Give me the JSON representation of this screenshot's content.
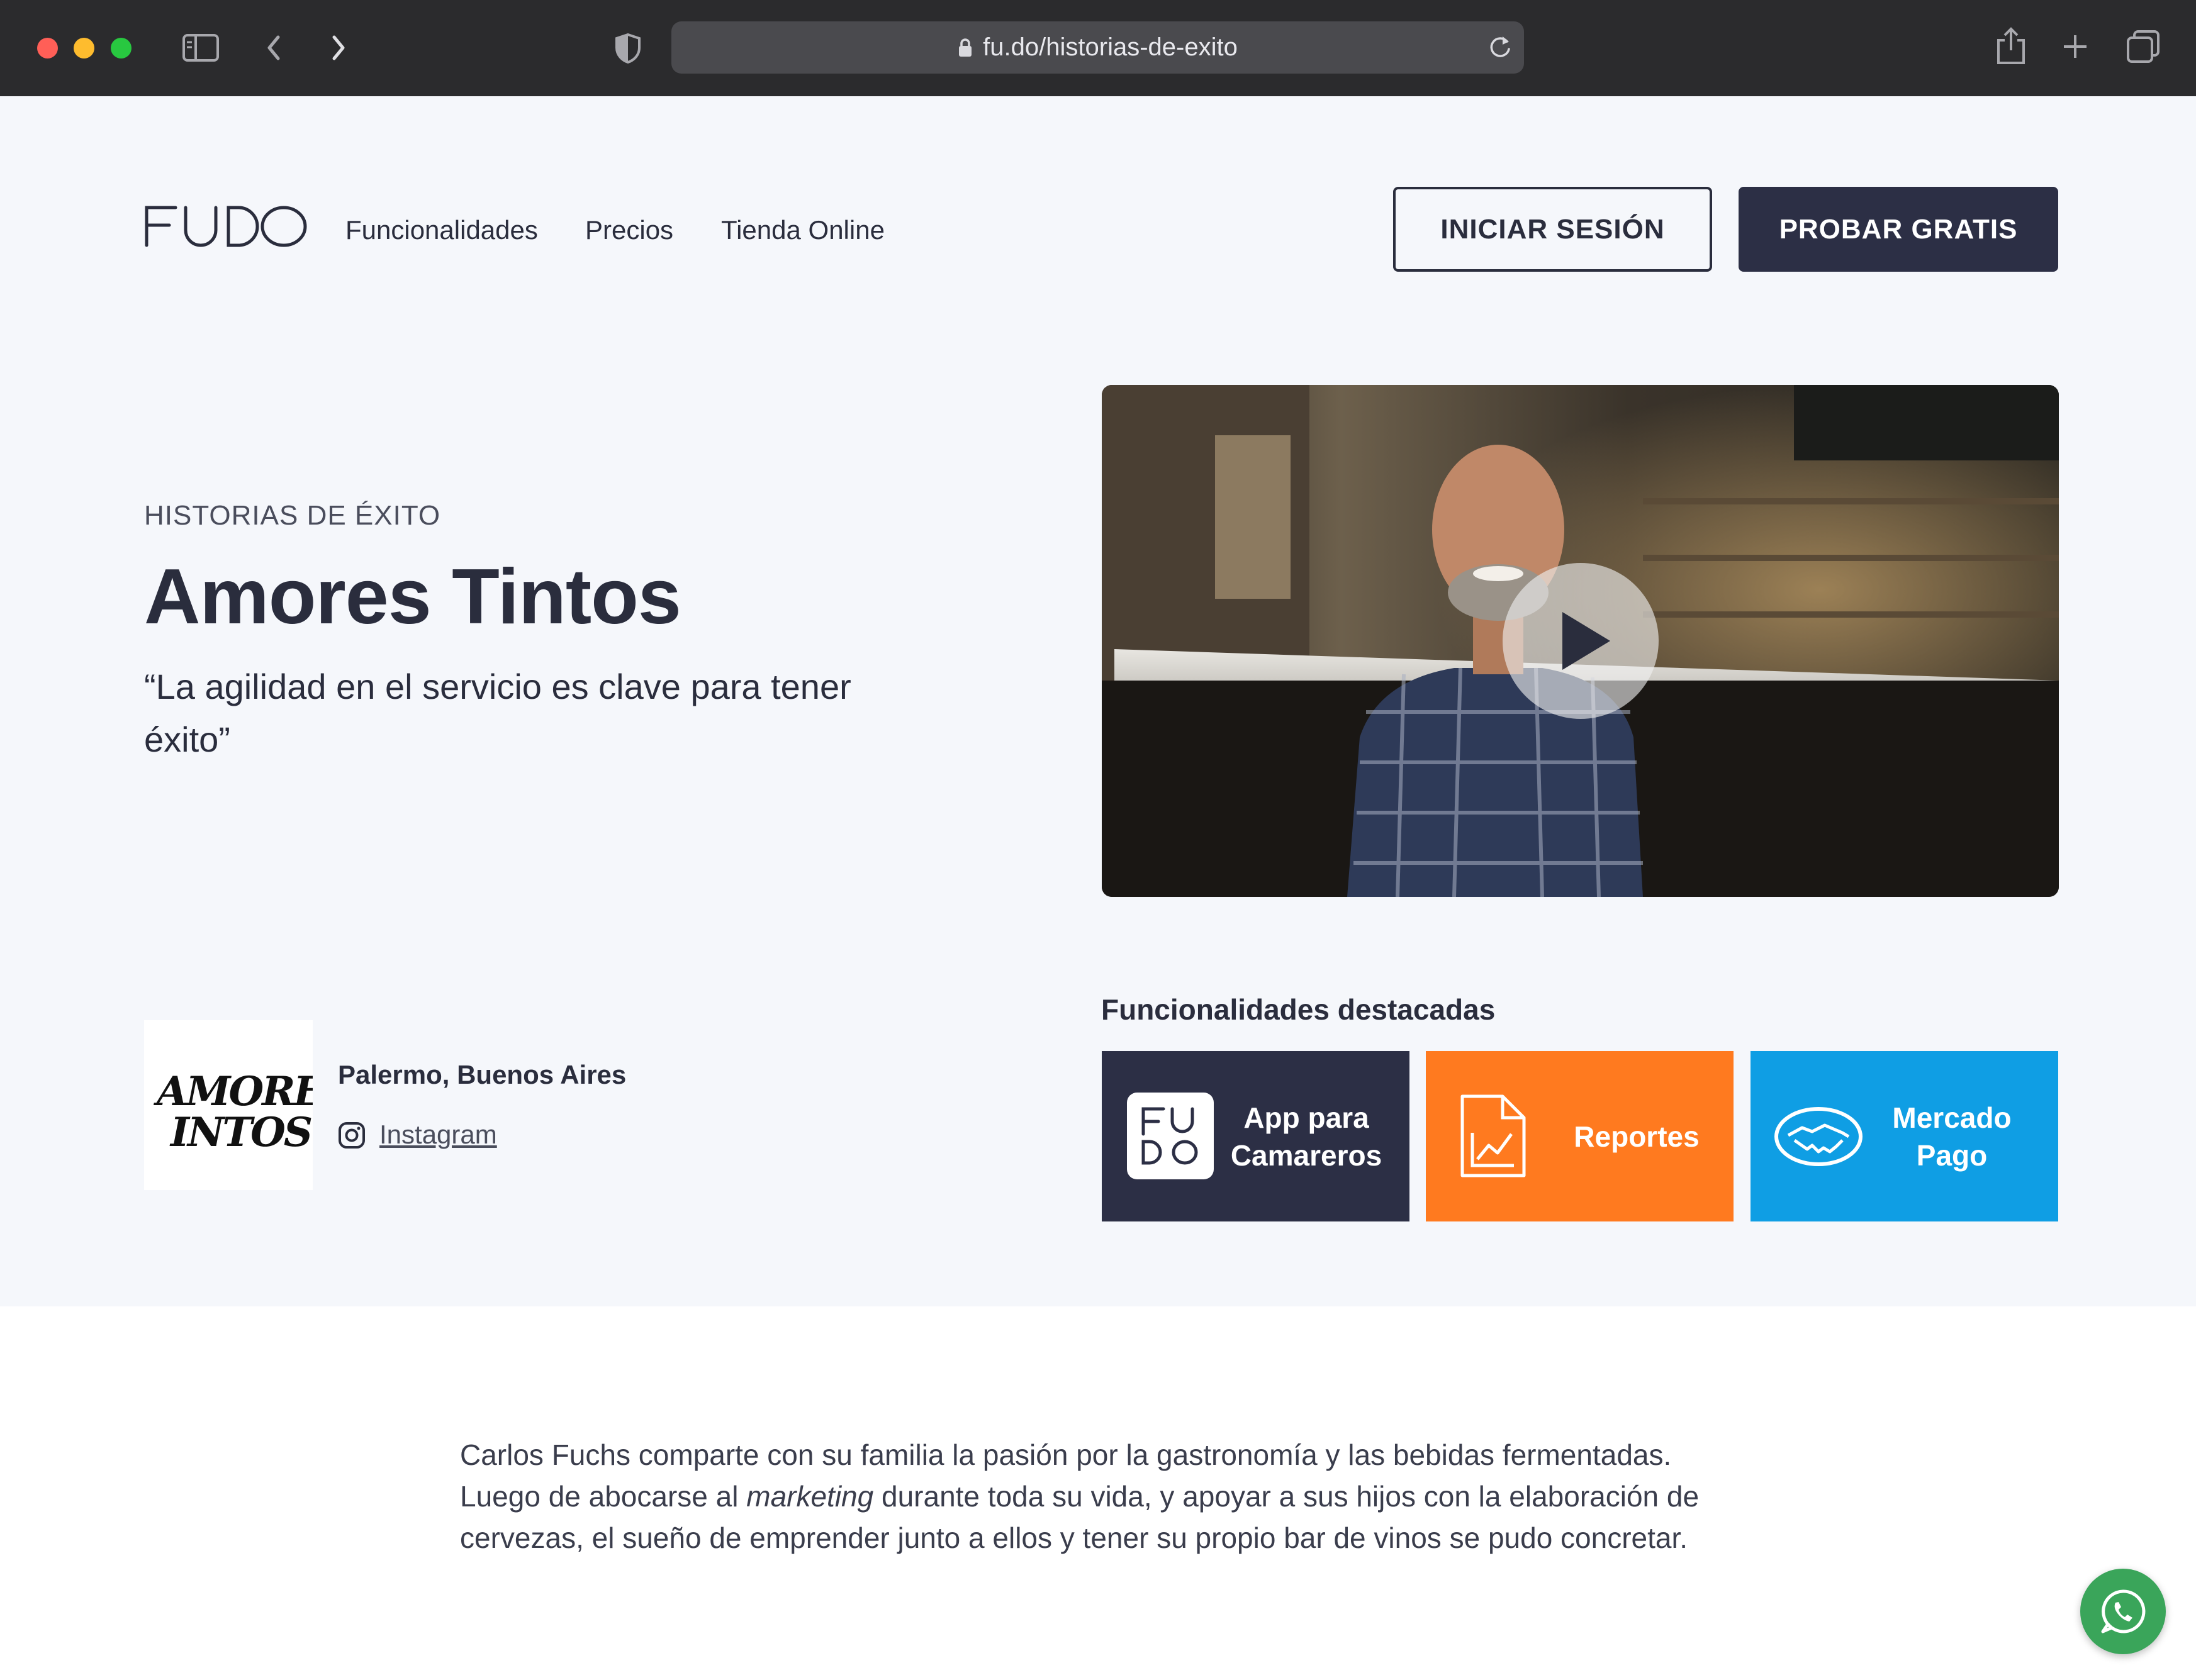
{
  "browser": {
    "url": "fu.do/historias-de-exito",
    "traffic_colors": [
      "#ff5f57",
      "#febc2e",
      "#28c840"
    ]
  },
  "header": {
    "brand": "FUDO",
    "nav": [
      "Funcionalidades",
      "Precios",
      "Tienda Online"
    ],
    "login_label": "INICIAR SESIÓN",
    "trial_label": "PROBAR GRATIS"
  },
  "hero": {
    "eyebrow": "HISTORIAS DE ÉXITO",
    "title": "Amores Tintos",
    "quote": "“La agilidad en el servicio es clave para tener éxito”"
  },
  "business": {
    "logo_text": "AMORES INTOS",
    "location": "Palermo, Buenos Aires",
    "social_label": "Instagram"
  },
  "features": {
    "heading": "Funcionalidades destacadas",
    "tiles": [
      {
        "label": "App para Camareros",
        "color": "#2c2f45",
        "icon": "fudo-logo-icon"
      },
      {
        "label": "Reportes",
        "color": "#ff7a1f",
        "icon": "report-chart-icon"
      },
      {
        "label": "Mercado Pago",
        "color": "#0f9ee4",
        "icon": "handshake-icon"
      }
    ]
  },
  "story": {
    "line1": "Carlos Fuchs comparte con su familia la pasión por la gastronomía y las bebidas fermentadas.",
    "line2_pre": "Luego de abocarse al ",
    "line2_em": "marketing",
    "line2_post": " durante toda su vida, y apoyar a sus hijos con la elaboración de",
    "line3": "cervezas, el sueño de emprender junto a ellos y tener su propio bar de vinos se pudo concretar."
  },
  "colors": {
    "accent_dark": "#2c2f45",
    "page_bg": "#f5f7fb",
    "whatsapp": "#3aa55a"
  }
}
